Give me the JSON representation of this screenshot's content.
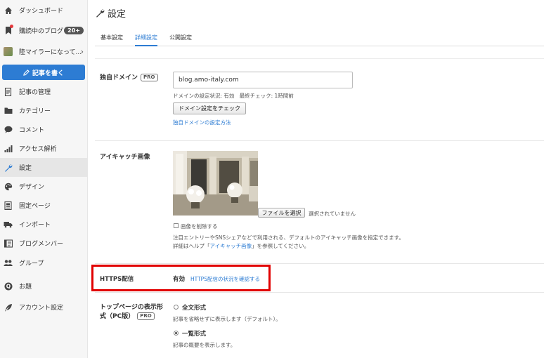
{
  "sidebar": {
    "items": [
      {
        "label": "ダッシュボード",
        "icon": "home-icon"
      },
      {
        "label": "購読中のブログ",
        "icon": "bookmark-icon",
        "badge": "20+"
      },
      {
        "label": "陸マイラーになって...",
        "icon": "blog-thumbnail-icon"
      },
      {
        "label": "記事の管理",
        "icon": "document-icon"
      },
      {
        "label": "カテゴリー",
        "icon": "folder-icon"
      },
      {
        "label": "コメント",
        "icon": "comment-icon"
      },
      {
        "label": "アクセス解析",
        "icon": "bar-chart-icon"
      },
      {
        "label": "設定",
        "icon": "wrench-icon"
      },
      {
        "label": "デザイン",
        "icon": "palette-icon"
      },
      {
        "label": "固定ページ",
        "icon": "page-icon"
      },
      {
        "label": "インポート",
        "icon": "truck-icon"
      },
      {
        "label": "ブログメンバー",
        "icon": "members-icon"
      },
      {
        "label": "グループ",
        "icon": "group-icon"
      },
      {
        "label": "お題",
        "icon": "topic-icon"
      },
      {
        "label": "アカウント設定",
        "icon": "feather-icon"
      }
    ],
    "write_button": "記事を書く"
  },
  "header": {
    "title": "設定"
  },
  "tabs": [
    {
      "label": "基本設定"
    },
    {
      "label": "詳細設定"
    },
    {
      "label": "公開設定"
    }
  ],
  "domain": {
    "label": "独自ドメイン",
    "pro": "PRO",
    "value": "blog.amo-italy.com",
    "status": "ドメインの設定状況: 有効",
    "last_check": "最終チェック: 1時間前",
    "check_button": "ドメイン設定をチェック",
    "help_link": "独自ドメインの設定方法"
  },
  "eyecatch": {
    "label": "アイキャッチ画像",
    "file_button": "ファイルを選択",
    "file_status": "選択されていません",
    "delete_label": "画像を削除する",
    "note1": "注目エントリーやSNSシェアなどで利用される、デフォルトのアイキャッチ画像を指定できます。",
    "note2_prefix": "詳細はヘルプ「",
    "note2_link": "アイキャッチ画像",
    "note2_suffix": "」を参照してください。"
  },
  "https": {
    "label": "HTTPS配信",
    "status": "有効",
    "link": "HTTPS配信の状況を確認する"
  },
  "toppage": {
    "label_line1": "トップページの表示形",
    "label_line2": "式（PC版）",
    "pro": "PRO",
    "option1": "全文形式",
    "option1_desc": "記事を省略せずに表示します（デフォルト）。",
    "option2": "一覧形式",
    "option2_desc": "記事の概要を表示します。"
  },
  "colors": {
    "accent": "#2d7cd3",
    "highlight": "#e10000"
  }
}
